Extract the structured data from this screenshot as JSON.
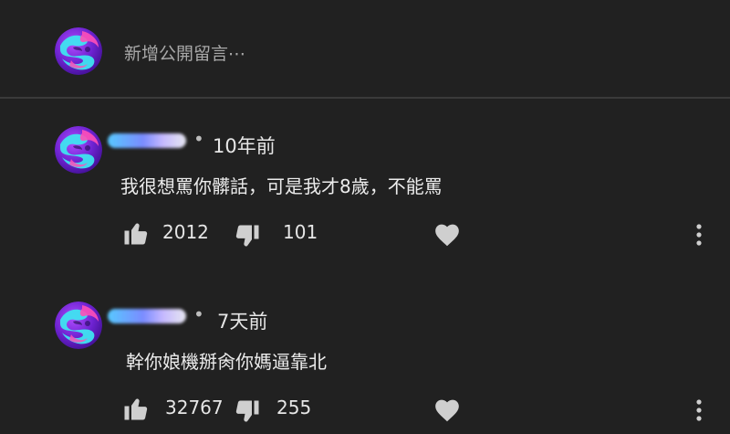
{
  "add_comment": {
    "placeholder": "新增公開留言⋯"
  },
  "comments": [
    {
      "timestamp": "10年前",
      "text": "我很想罵你髒話，可是我才8歲，不能罵",
      "likes": "2012",
      "dislikes": "101"
    },
    {
      "timestamp": "7天前",
      "text": "幹你娘機掰肏你媽逼靠北",
      "likes": "32767",
      "dislikes": "255"
    }
  ],
  "meta_separator": "•",
  "colors": {
    "background": "#212121",
    "divider": "#3a3a3a",
    "text": "#e8e8e8",
    "placeholder": "#a8a8a8",
    "icon": "#cfcfcf",
    "avatar_purple": "#7a2fd8",
    "avatar_cyan": "#3fe3f0",
    "avatar_pink": "#ff4fb8"
  },
  "icons": {
    "avatar": "swirl-orb-avatar",
    "like": "thumbs-up-icon",
    "dislike": "thumbs-down-icon",
    "heart": "heart-icon",
    "more": "more-vertical-icon"
  }
}
